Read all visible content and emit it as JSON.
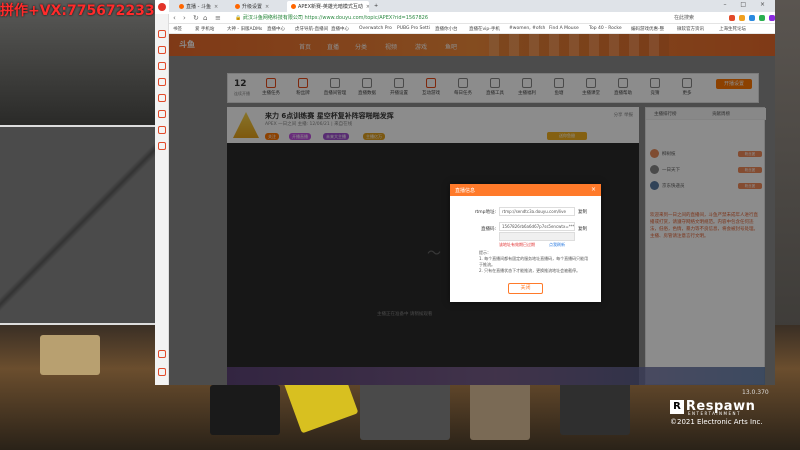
{
  "overlay": {
    "watermark": "拼作+VX:775672233"
  },
  "browser": {
    "tabs": [
      {
        "label": "直播 - 斗鱼"
      },
      {
        "label": "升级设置"
      },
      {
        "label": "APEX新赛-英雄光暗模式互动"
      }
    ],
    "address": {
      "secure_text": "武汉斗鱼网络科技有限公司",
      "url": "https://www.douyu.com/topic/APEX?rid=1567826"
    },
    "search_text": "在此搜索",
    "bookmarks": [
      "书签",
      "爱 手机站",
      "大神 - 旧版ADMs",
      "直播中心",
      "虎牙导航-直播间",
      "直播中心",
      "Overwatch Pro",
      "PUBG Pro Setti",
      "直播你小台",
      "直播在vip-手机",
      "#women, #ofsh",
      "Find A Mouse",
      "Top 40 - Rocke",
      "编码游戏优惠-整",
      "微软官方资讯",
      "上海生死论坛"
    ]
  },
  "douyu": {
    "logo": "斗鱼",
    "nav": [
      "首页",
      "直播",
      "分类",
      "视频",
      "游戏",
      "鱼吧"
    ],
    "toolbar": {
      "day_num": "12",
      "day_label": "连续开播",
      "items": [
        "主播任务",
        "粉丝牌",
        "直播间管理",
        "直播数据",
        "开播设置",
        "互动游戏",
        "每日任务",
        "直播工具",
        "主播福利",
        "鱼塘",
        "主播课堂",
        "直播帮助",
        "竞猜",
        "更多"
      ],
      "follow": "开播设置"
    },
    "room": {
      "title": "来力 6点训练赛 星空杯复补阵容啪啪发挥",
      "meta": "APEX  一日之间  主播: 12/06/21 | 来自在线",
      "tags": [
        "关注",
        "开播直播",
        "未来大主播",
        "主播亿万"
      ],
      "actions": "分享   举报",
      "gift": "送你鱼翅",
      "player_text": "主播正在准备中  请稍候观看"
    },
    "chat": {
      "tabs": [
        "主播排行榜",
        "贡献周榜"
      ],
      "ranks": [
        {
          "name": "柳树枝"
        },
        {
          "name": "一日天下"
        },
        {
          "name": "京东快递员"
        }
      ],
      "badge": "粉丝团",
      "notice": "欢迎来到一日之间的直播间，斗鱼严禁未成年人进行直播或打赏，请遵守网络文明规范。内容中包含任何违法，低俗，色情，暴力等不良信息，将会被封号处理。主播、房管请注意言行文明。"
    }
  },
  "modal": {
    "title": "直播信息",
    "close": "×",
    "rtmp_label": "rtmp地址:",
    "rtmp_value": "rtmp://sendtc3a.douyu.com/live",
    "key_label": "直播码:",
    "key_value": "1567826rb6a6d67p7ss5encwtx=*****************",
    "copy": "复制",
    "warn": "该地址有效期已过期",
    "link": "点我刷新",
    "tips": "提示：\n1. 每个直播间都有固定的服务地址直播码，每个直播码只能用于推流。\n2. 只有在直播状态下才能推流，更换推流地址会被截停。",
    "button": "关闭"
  },
  "game": {
    "version": "13.0.370",
    "brand": "Respawn",
    "brand_sub": "ENTERTAINMENT",
    "copyright": "©2021 Electronic Arts Inc."
  }
}
